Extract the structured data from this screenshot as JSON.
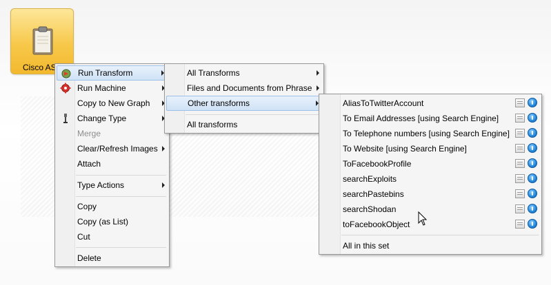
{
  "entity": {
    "label": "Cisco AS",
    "icon": "clipboard-icon"
  },
  "context_menu": {
    "items": [
      {
        "label": "Run Transform",
        "icon": "run-transform-icon",
        "submenu": true,
        "highlighted": true
      },
      {
        "label": "Run Machine",
        "icon": "run-machine-icon",
        "submenu": true
      },
      {
        "label": "Copy to New Graph",
        "submenu": true
      },
      {
        "label": "Change Type",
        "icon": "change-type-icon",
        "submenu": true
      },
      {
        "label": "Merge",
        "disabled": true
      },
      {
        "label": "Clear/Refresh Images",
        "submenu": true
      },
      {
        "label": "Attach"
      },
      {
        "label": "Type Actions",
        "submenu": true
      },
      {
        "label": "Copy"
      },
      {
        "label": "Copy (as List)"
      },
      {
        "label": "Cut"
      },
      {
        "label": "Delete"
      }
    ]
  },
  "transform_menu": {
    "items": [
      {
        "label": "All Transforms",
        "submenu": true
      },
      {
        "label": "Files and Documents from Phrase",
        "submenu": true
      },
      {
        "label": "Other transforms",
        "submenu": true,
        "highlighted": true
      },
      {
        "label": "All transforms"
      }
    ]
  },
  "other_transforms_menu": {
    "items": [
      {
        "label": "AliasToTwitterAccount"
      },
      {
        "label": "To Email Addresses [using Search Engine]"
      },
      {
        "label": "To Telephone numbers [using Search Engine]"
      },
      {
        "label": "To Website [using Search Engine]"
      },
      {
        "label": "ToFacebookProfile"
      },
      {
        "label": "searchExploits"
      },
      {
        "label": "searchPastebins"
      },
      {
        "label": "searchShodan"
      },
      {
        "label": "toFacebookObject"
      }
    ],
    "footer": "All in this set"
  },
  "colors": {
    "highlight": "#cfe2f6",
    "entity_fill": "#f7c84a",
    "menu_bg": "#f5f5f5"
  }
}
